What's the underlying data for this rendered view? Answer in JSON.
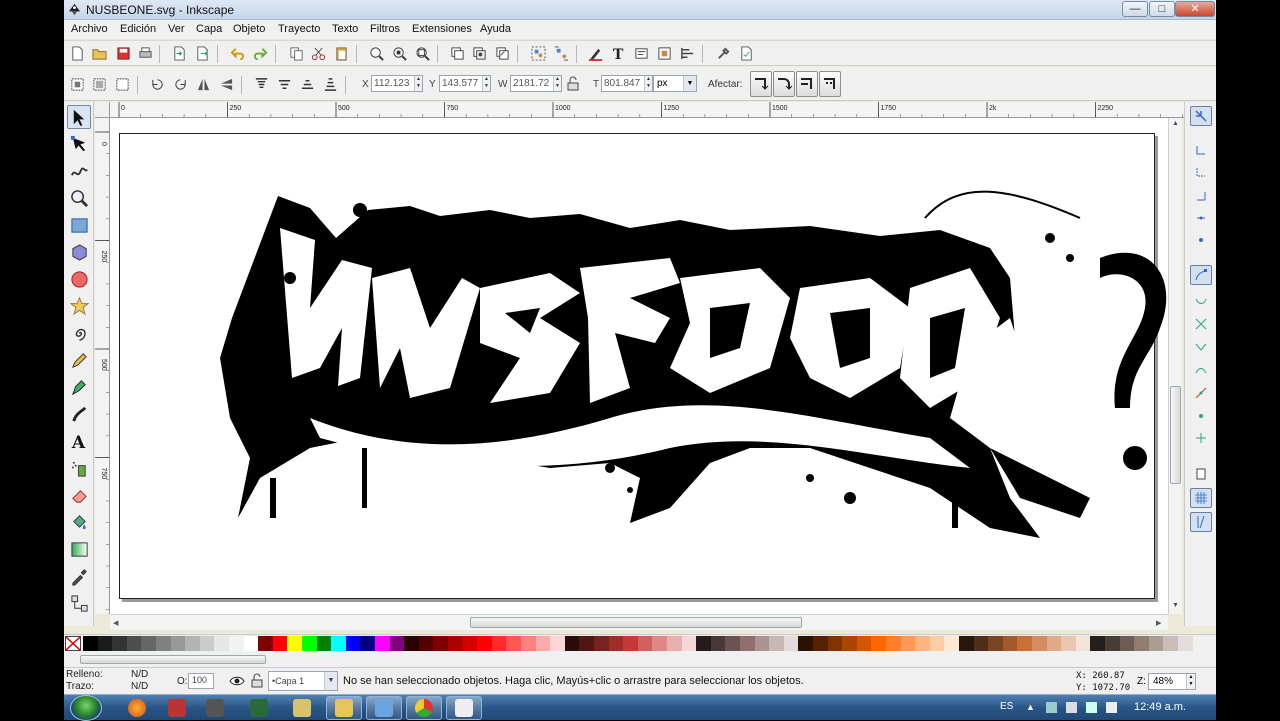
{
  "window": {
    "title": "NUSBEONE.svg - Inkscape",
    "minimize": "—",
    "maximize": "□",
    "close": "✕"
  },
  "menubar": [
    "Archivo",
    "Edición",
    "Ver",
    "Capa",
    "Objeto",
    "Trayecto",
    "Texto",
    "Filtros",
    "Extensiones",
    "Ayuda"
  ],
  "controls": {
    "x_label": "X",
    "x_value": "112.123",
    "y_label": "Y",
    "y_value": "143.577",
    "w_label": "W",
    "w_value": "2181.72",
    "h_label": "T",
    "h_value": "801.847",
    "unit": "px",
    "affect_label": "Afectar:"
  },
  "ruler": {
    "h_ticks": [
      "0",
      "250",
      "500",
      "750",
      "1000",
      "1250",
      "1500",
      "1750",
      "2k",
      "2250"
    ],
    "v_ticks": [
      "0",
      "250",
      "500",
      "750"
    ]
  },
  "palette": [
    "#000000",
    "#1a1a1a",
    "#333333",
    "#4d4d4d",
    "#666666",
    "#808080",
    "#999999",
    "#b3b3b3",
    "#cccccc",
    "#e6e6e6",
    "#f2f2f2",
    "#ffffff",
    "#800000",
    "#ff0000",
    "#ffff00",
    "#00ff00",
    "#008000",
    "#00ffff",
    "#0000ff",
    "#000080",
    "#ff00ff",
    "#800080",
    "#2b0000",
    "#550000",
    "#800000",
    "#aa0000",
    "#d40000",
    "#ff0000",
    "#ff2a2a",
    "#ff5555",
    "#ff8080",
    "#ffaaaa",
    "#ffd5d5",
    "#280b0b",
    "#501616",
    "#782121",
    "#a02c2c",
    "#c83737",
    "#d35f5f",
    "#de8787",
    "#e9afaf",
    "#f4d7d7",
    "#241c1c",
    "#483737",
    "#6c5353",
    "#916f6f",
    "#ac9393",
    "#c8b7b7",
    "#e3dbdb",
    "#2b1100",
    "#552200",
    "#803300",
    "#aa4400",
    "#d45500",
    "#ff6600",
    "#ff7f2a",
    "#ff9955",
    "#ffb380",
    "#ffccaa",
    "#ffe6d5",
    "#28170b",
    "#502d16",
    "#784421",
    "#a05a2c",
    "#c87137",
    "#d38d5f",
    "#deaa87",
    "#e9c6af",
    "#f4e3d7",
    "#241f1c",
    "#483e37",
    "#6c5d53",
    "#917c6f",
    "#ac9d93",
    "#c8beb7",
    "#e3dedb"
  ],
  "status": {
    "fill_label": "Relleno:",
    "fill_value": "N/D",
    "stroke_label": "Trazo:",
    "stroke_value": "N/D",
    "opacity_label": "O:",
    "opacity_value": "100",
    "layer": "•Capa 1",
    "message": "No se han seleccionado objetos. Haga clic, Mayús+clic o arrastre para seleccionar los objetos.",
    "cursor_x": "X:  260.87",
    "cursor_y": "Y: 1072.70",
    "zoom_label": "Z:",
    "zoom_value": "48%"
  },
  "taskbar": {
    "language": "ES",
    "clock": "12:49 a.m."
  }
}
